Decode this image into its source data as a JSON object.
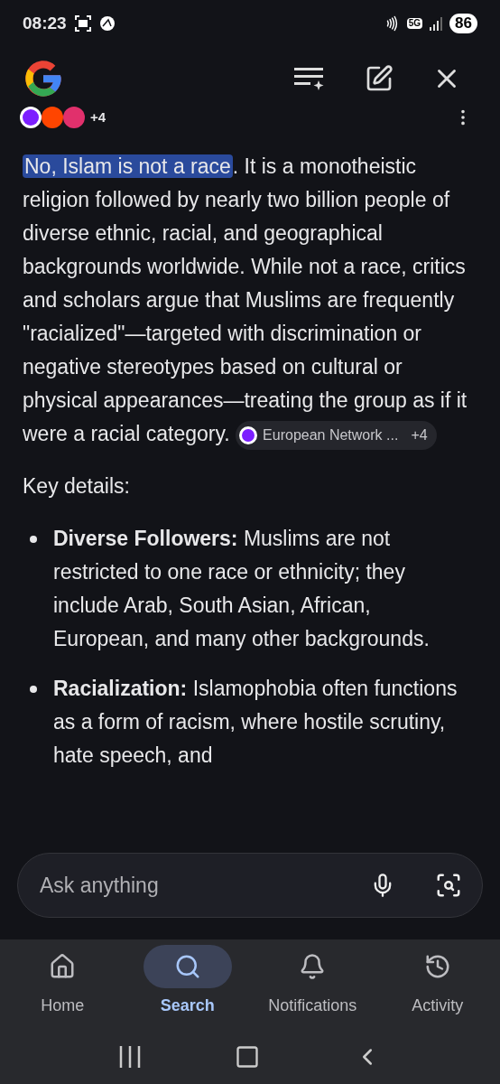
{
  "status_bar": {
    "time": "08:23",
    "network": "5G",
    "battery": "86"
  },
  "sources": {
    "count": "+4"
  },
  "answer": {
    "highlight": "No, Islam is not a race",
    "text": ". It is a monotheistic religion followed by nearly two billion people of diverse ethnic, racial, and geographical backgrounds worldwide. While not a race, critics and scholars argue that Muslims are frequently \"racialized\"—targeted with discrimination or negative stereotypes based on cultural or physical appearances—treating the group as if it were a racial category.",
    "citation": {
      "label": "European Network ...",
      "count": "+4"
    }
  },
  "key_details": {
    "heading": "Key details:",
    "bullets": [
      {
        "text": "**Diverse Followers:** Muslims are not restricted to one race or ethnicity; they include Arab, South Asian, African, European, and many other backgrounds."
      },
      {
        "text": "**Racialization:** Islamophobia often functions as a form of racism, where hostile scrutiny, hate speech, and"
      }
    ]
  },
  "search": {
    "placeholder": "Ask anything"
  },
  "nav": [
    {
      "label": "Home",
      "selected": false
    },
    {
      "label": "Search",
      "selected": true
    },
    {
      "label": "Notifications",
      "selected": false
    },
    {
      "label": "Activity",
      "selected": false
    }
  ]
}
